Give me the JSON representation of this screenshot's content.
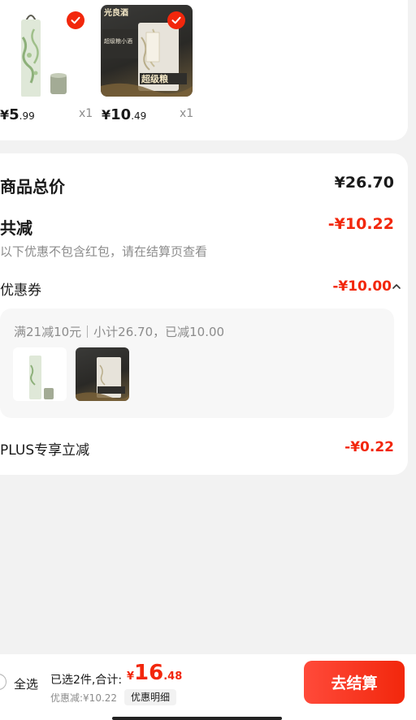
{
  "products": [
    {
      "price_currency": "¥",
      "price_int": "5",
      "price_dec": ".99",
      "qty": "x1",
      "checked": true
    },
    {
      "price_currency": "¥",
      "price_int": "10",
      "price_dec": ".49",
      "qty": "x1",
      "checked": true,
      "brand_text": "光良酒",
      "label_text": "超级粮小酒",
      "big_text": "超级粮"
    }
  ],
  "summary": {
    "total_label": "商品总价",
    "total_value": "¥26.70",
    "reduce_label": "共减",
    "reduce_value": "-¥10.22",
    "note": "以下优惠不包含红包，请在结算页查看",
    "coupon_label": "优惠券",
    "coupon_value": "-¥10.00",
    "coupon_desc": "满21减10元｜小计26.70，已减10.00",
    "plus_label": "PLUS专享立减",
    "plus_value": "-¥0.22"
  },
  "bottom": {
    "select_all": "全选",
    "selected_text": "已选2件,合计:",
    "sum_currency": "¥",
    "sum_int": "16",
    "sum_dec": ".48",
    "discount_text": "优惠减:¥10.22",
    "detail_button": "优惠明细",
    "checkout_button": "去结算"
  },
  "colors": {
    "accent": "#f2270c",
    "muted": "#8c8c8c",
    "background": "#f2f2f2"
  }
}
